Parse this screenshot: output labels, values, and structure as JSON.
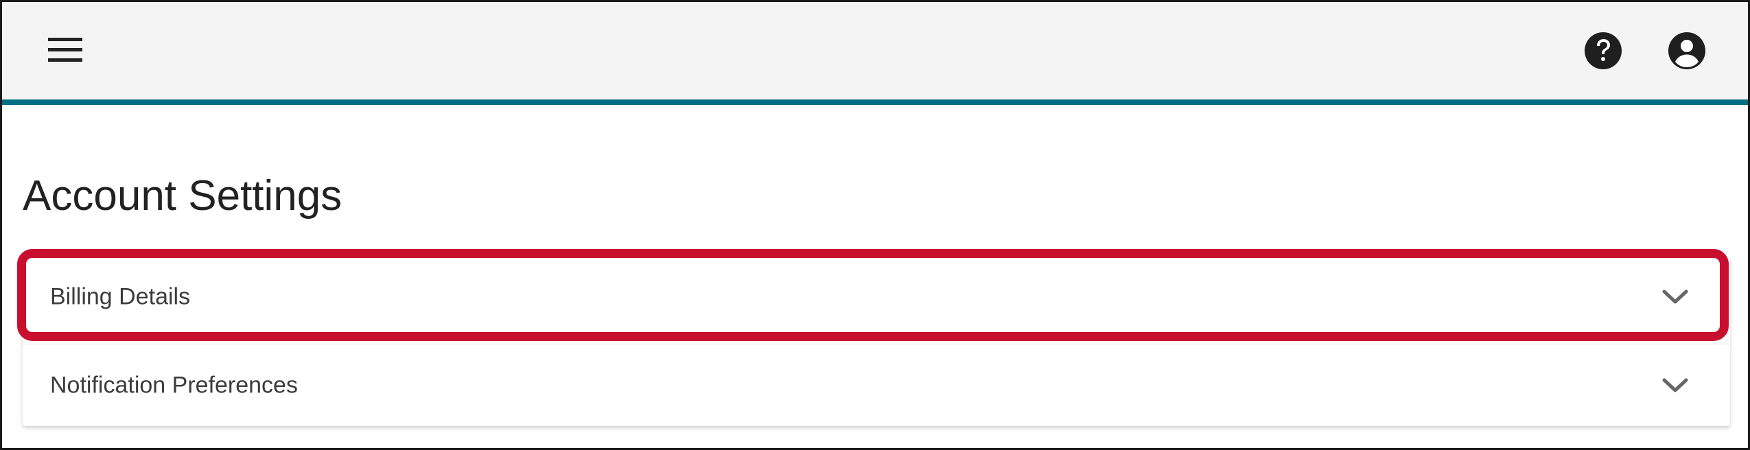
{
  "header": {
    "menu_icon": "hamburger-menu-icon",
    "help_icon": "help-circle-icon",
    "account_icon": "account-circle-icon",
    "accent_color": "#006f84"
  },
  "page": {
    "title": "Account Settings"
  },
  "accordion": {
    "items": [
      {
        "label": "Billing Details",
        "icon": "chevron-down-icon",
        "highlighted": true
      },
      {
        "label": "Notification Preferences",
        "icon": "chevron-down-icon",
        "highlighted": false
      }
    ]
  },
  "annotation": {
    "highlight_color": "#c8102e"
  }
}
